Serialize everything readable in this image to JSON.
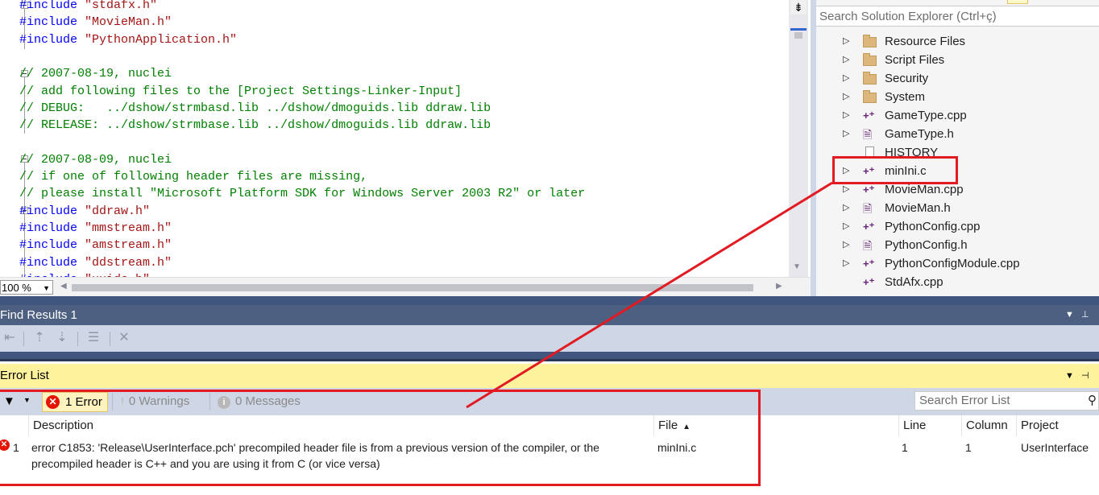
{
  "editor": {
    "lines": [
      {
        "segments": [
          {
            "k": "kw",
            "t": "#include "
          },
          {
            "k": "s",
            "t": "\"stdafx.h\""
          }
        ]
      },
      {
        "segments": [
          {
            "k": "kw",
            "t": "#include "
          },
          {
            "k": "s",
            "t": "\"MovieMan.h\""
          }
        ]
      },
      {
        "segments": [
          {
            "k": "kw",
            "t": "#include "
          },
          {
            "k": "s",
            "t": "\"PythonApplication.h\""
          }
        ]
      },
      {
        "segments": []
      },
      {
        "segments": [
          {
            "k": "c",
            "t": "// 2007-08-19, nuclei"
          }
        ]
      },
      {
        "segments": [
          {
            "k": "c",
            "t": "// add following files to the [Project Settings-Linker-Input]"
          }
        ]
      },
      {
        "segments": [
          {
            "k": "c",
            "t": "// DEBUG:   ../dshow/strmbasd.lib ../dshow/dmoguids.lib ddraw.lib"
          }
        ]
      },
      {
        "segments": [
          {
            "k": "c",
            "t": "// RELEASE: ../dshow/strmbase.lib ../dshow/dmoguids.lib ddraw.lib"
          }
        ]
      },
      {
        "segments": []
      },
      {
        "segments": [
          {
            "k": "c",
            "t": "// 2007-08-09, nuclei"
          }
        ]
      },
      {
        "segments": [
          {
            "k": "c",
            "t": "// if one of following header files are missing,"
          }
        ]
      },
      {
        "segments": [
          {
            "k": "c",
            "t": "// please install \"Microsoft Platform SDK for Windows Server 2003 R2\" or later"
          }
        ]
      },
      {
        "segments": [
          {
            "k": "kw",
            "t": "#include "
          },
          {
            "k": "s",
            "t": "\"ddraw.h\""
          }
        ]
      },
      {
        "segments": [
          {
            "k": "kw",
            "t": "#include "
          },
          {
            "k": "s",
            "t": "\"mmstream.h\""
          }
        ]
      },
      {
        "segments": [
          {
            "k": "kw",
            "t": "#include "
          },
          {
            "k": "s",
            "t": "\"amstream.h\""
          }
        ]
      },
      {
        "segments": [
          {
            "k": "kw",
            "t": "#include "
          },
          {
            "k": "s",
            "t": "\"ddstream.h\""
          }
        ]
      },
      {
        "segments": [
          {
            "k": "kw",
            "t": "#include "
          },
          {
            "k": "s",
            "t": "\"uuids.h\""
          }
        ]
      }
    ],
    "zoom": "100 %",
    "colors": {
      "keyword": "#0000ff",
      "string": "#a31515",
      "comment": "#008000"
    }
  },
  "solution_explorer": {
    "search_placeholder": "Search Solution Explorer (Ctrl+ç)",
    "items": [
      {
        "label": "Resource Files",
        "icon": "folder-icon",
        "expandable": true
      },
      {
        "label": "Script Files",
        "icon": "folder-icon",
        "expandable": true
      },
      {
        "label": "Security",
        "icon": "folder-icon",
        "expandable": true
      },
      {
        "label": "System",
        "icon": "folder-icon",
        "expandable": true
      },
      {
        "label": "GameType.cpp",
        "icon": "cpp-file-icon",
        "expandable": true
      },
      {
        "label": "GameType.h",
        "icon": "header-file-icon",
        "expandable": true
      },
      {
        "label": "HISTORY",
        "icon": "text-file-icon",
        "expandable": false
      },
      {
        "label": "minIni.c",
        "icon": "cpp-file-icon",
        "expandable": true
      },
      {
        "label": "MovieMan.cpp",
        "icon": "cpp-file-icon",
        "expandable": true
      },
      {
        "label": "MovieMan.h",
        "icon": "header-file-icon",
        "expandable": true
      },
      {
        "label": "PythonConfig.cpp",
        "icon": "cpp-file-icon",
        "expandable": true
      },
      {
        "label": "PythonConfig.h",
        "icon": "header-file-icon",
        "expandable": true
      },
      {
        "label": "PythonConfigModule.cpp",
        "icon": "cpp-file-icon",
        "expandable": true
      },
      {
        "label": "StdAfx.cpp",
        "icon": "cpp-file-icon",
        "expandable": false
      }
    ]
  },
  "find_results": {
    "title": "Find Results 1"
  },
  "error_list": {
    "title": "Error List",
    "errors_button": "1 Error",
    "warnings_button": "0 Warnings",
    "messages_button": "0 Messages",
    "search_placeholder": "Search Error List",
    "columns": {
      "description": "Description",
      "file": "File",
      "line": "Line",
      "column": "Column",
      "project": "Project"
    },
    "rows": [
      {
        "index": "1",
        "description_line1": "error C1853: 'Release\\UserInterface.pch' precompiled header file is from a previous version of the compiler, or the",
        "description_line2": "precompiled header is C++ and you are using it from C (or vice versa)",
        "file": "minIni.c",
        "line": "1",
        "column": "1",
        "project": "UserInterface"
      }
    ]
  },
  "annotation_color": "#e21a22"
}
